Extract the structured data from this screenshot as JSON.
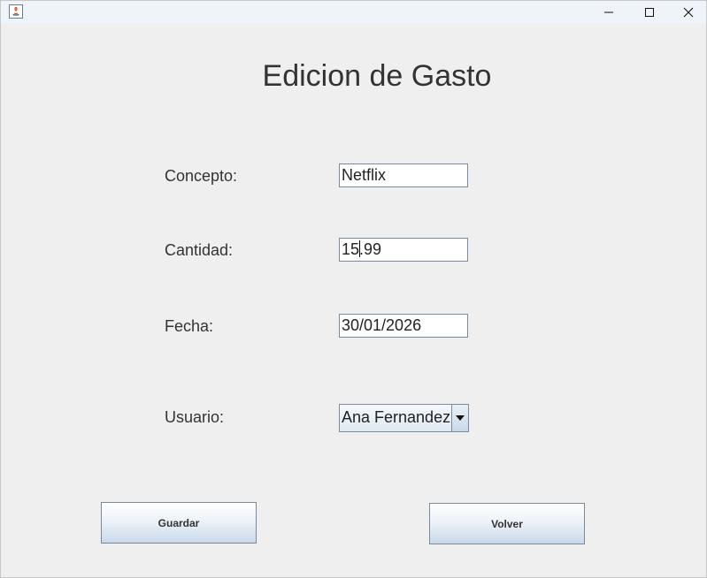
{
  "window": {
    "controls": {
      "minimize": "minimize-icon",
      "maximize": "maximize-icon",
      "close": "close-icon"
    }
  },
  "form": {
    "title": "Edicion de Gasto",
    "concepto": {
      "label": "Concepto:",
      "value": "Netflix"
    },
    "cantidad": {
      "label": "Cantidad:",
      "value_before_caret": "15",
      "value_after_caret": ".99"
    },
    "fecha": {
      "label": "Fecha:",
      "value": "30/01/2026"
    },
    "usuario": {
      "label": "Usuario:",
      "selected": "Ana Fernandez"
    }
  },
  "buttons": {
    "save": "Guardar",
    "back": "Volver"
  },
  "colors": {
    "window_bg": "#efefef",
    "titlebar_bg": "#eef4f9",
    "text": "#333333",
    "border": "#7a8a99"
  }
}
